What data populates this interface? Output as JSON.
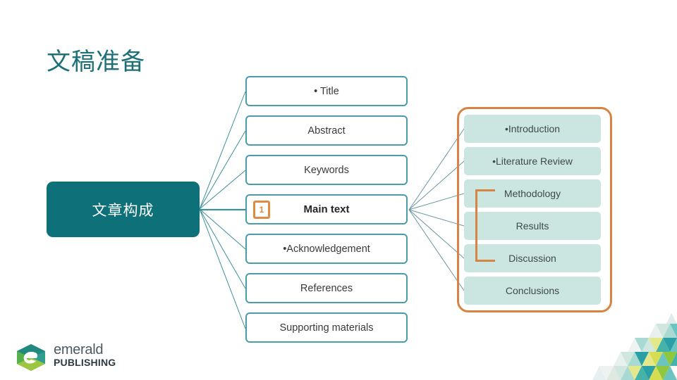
{
  "slide": {
    "title": "文稿准备",
    "title_color": "#1f6f78",
    "background": "#ffffff"
  },
  "root": {
    "label": "文章构成",
    "fill": "#0e7179",
    "text_color": "#ffffff"
  },
  "middle_column": {
    "border_color": "#4a9ca6",
    "items": [
      {
        "label": "• Title",
        "emphasis": false,
        "badge": null
      },
      {
        "label": "Abstract",
        "emphasis": false,
        "badge": null
      },
      {
        "label": "Keywords",
        "emphasis": false,
        "badge": null
      },
      {
        "label": "Main text",
        "emphasis": true,
        "badge": "1"
      },
      {
        "label": "•Acknowledgement",
        "emphasis": false,
        "badge": null
      },
      {
        "label": "References",
        "emphasis": false,
        "badge": null
      },
      {
        "label": "Supporting materials",
        "emphasis": false,
        "badge": null
      }
    ]
  },
  "right_column": {
    "fill": "#cbe5e0",
    "group_outline_color": "#d78343",
    "bracket_color": "#d78343",
    "items": [
      {
        "label": "•Introduction"
      },
      {
        "label": "•Literature Review"
      },
      {
        "label": "Methodology"
      },
      {
        "label": "Results"
      },
      {
        "label": "Discussion"
      },
      {
        "label": "Conclusions"
      }
    ]
  },
  "logo": {
    "word_1": "emerald",
    "word_2": "PUBLISHING",
    "mark_colors": [
      "#1f8a7d",
      "#56b04b",
      "#c9d23a",
      "#2f9e8f"
    ]
  },
  "mosaic": {
    "colors": [
      "#2aa0a6",
      "#6cc4c0",
      "#a8d9d2",
      "#cfe7df",
      "#d6dd52",
      "#e3e88a",
      "#8fc73e",
      "#45b3a8"
    ]
  }
}
